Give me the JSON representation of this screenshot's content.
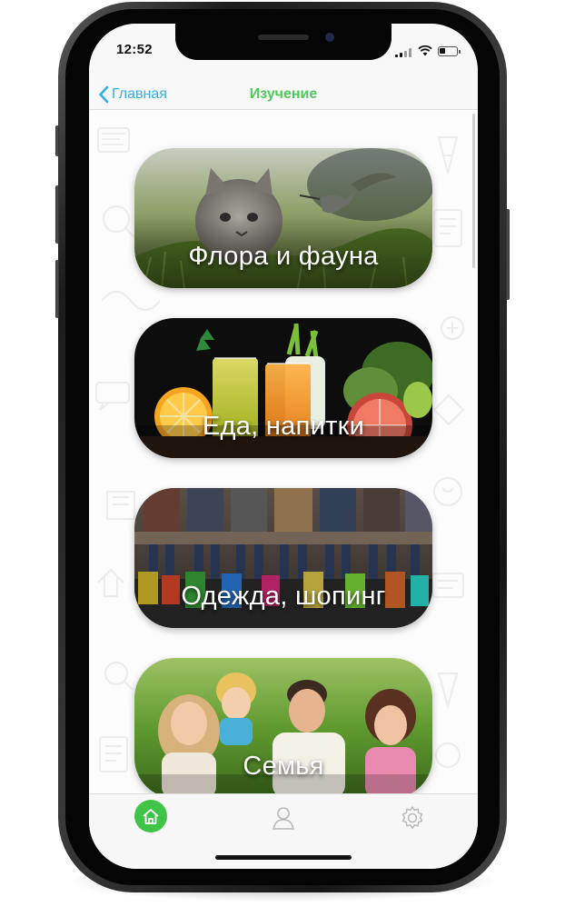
{
  "status_bar": {
    "time": "12:52",
    "battery_level": 0.35
  },
  "nav": {
    "back_label": "Главная",
    "title": "Изучение"
  },
  "categories": [
    {
      "label": "Флора и фауна"
    },
    {
      "label": "Еда, напитки"
    },
    {
      "label": "Одежда, шопинг"
    },
    {
      "label": "Семья"
    }
  ],
  "tabbar": {
    "items": [
      {
        "icon": "home-icon",
        "active": true
      },
      {
        "icon": "profile-icon",
        "active": false
      },
      {
        "icon": "gear-icon",
        "active": false
      }
    ]
  },
  "colors": {
    "accent_blue": "#33aee0",
    "title_green": "#4fc95a",
    "tab_active_green": "#3fc447"
  }
}
